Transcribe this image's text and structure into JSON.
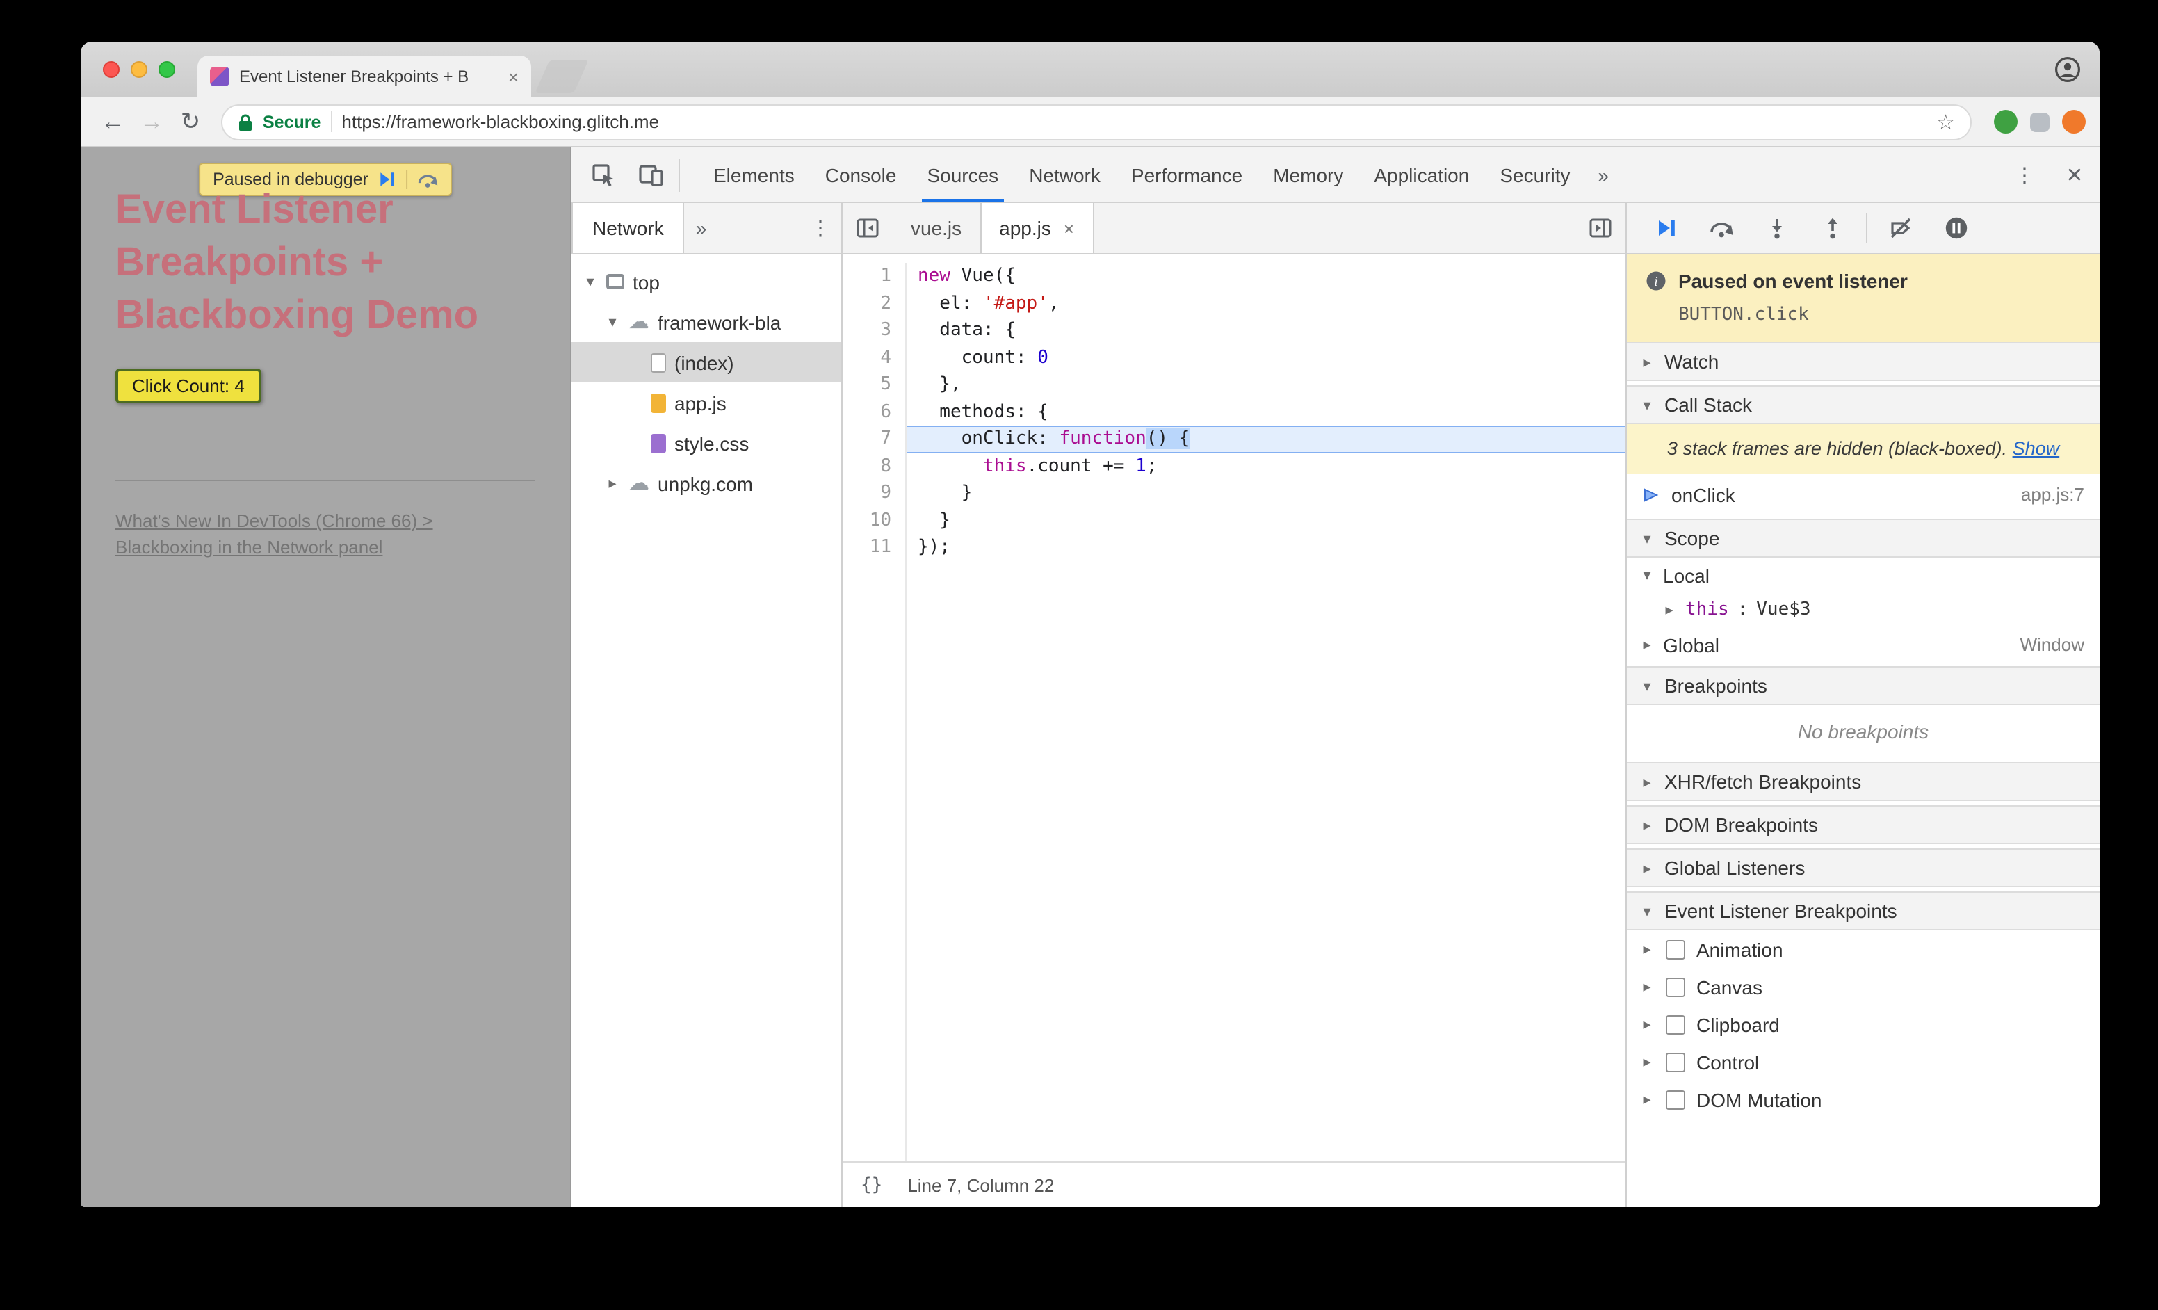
{
  "chrome": {
    "tab_title": "Event Listener Breakpoints + B",
    "secure_label": "Secure",
    "url": "https://framework-blackboxing.glitch.me"
  },
  "page": {
    "paused_banner_label": "Paused in debugger",
    "heading": "Event Listener\nBreakpoints +\nBlackboxing Demo",
    "click_button_label": "Click Count: 4",
    "link_text": "What's New In DevTools (Chrome 66) >\nBlackboxing in the Network panel"
  },
  "devtools": {
    "tabs": [
      "Elements",
      "Console",
      "Sources",
      "Network",
      "Performance",
      "Memory",
      "Application",
      "Security"
    ],
    "active_tab": "Sources",
    "navigator": {
      "active_tab": "Network",
      "tree": [
        {
          "label": "top",
          "icon": "frame",
          "arrow": "expanded",
          "depth": 0
        },
        {
          "label": "framework-bla",
          "icon": "cloud",
          "arrow": "expanded",
          "depth": 1
        },
        {
          "label": "(index)",
          "icon": "document",
          "arrow": "none",
          "depth": 2,
          "selected": true
        },
        {
          "label": "app.js",
          "icon": "js-file",
          "arrow": "none",
          "depth": 2
        },
        {
          "label": "style.css",
          "icon": "css-file",
          "arrow": "none",
          "depth": 2
        },
        {
          "label": "unpkg.com",
          "icon": "cloud",
          "arrow": "collapsed",
          "depth": 1
        }
      ]
    },
    "editor": {
      "tabs": [
        {
          "label": "vue.js",
          "active": false,
          "closable": false
        },
        {
          "label": "app.js",
          "active": true,
          "closable": true
        }
      ],
      "paused_line": 7,
      "code_lines": [
        [
          [
            "kw",
            "new"
          ],
          [
            "pl",
            " Vue({"
          ]
        ],
        [
          [
            "pl",
            "  el: "
          ],
          [
            "str",
            "'#app'"
          ],
          [
            "pl",
            ","
          ]
        ],
        [
          [
            "pl",
            "  data: {"
          ]
        ],
        [
          [
            "pl",
            "    count: "
          ],
          [
            "num",
            "0"
          ]
        ],
        [
          [
            "pl",
            "  },"
          ]
        ],
        [
          [
            "pl",
            "  methods: {"
          ]
        ],
        [
          [
            "pl",
            "    onClick: "
          ],
          [
            "kw",
            "function"
          ],
          [
            "sel",
            "() {"
          ]
        ],
        [
          [
            "pl",
            "      "
          ],
          [
            "kw",
            "this"
          ],
          [
            "pl",
            ".count += "
          ],
          [
            "num",
            "1"
          ],
          [
            "pl",
            ";"
          ]
        ],
        [
          [
            "pl",
            "    }"
          ]
        ],
        [
          [
            "pl",
            "  }"
          ]
        ],
        [
          [
            "pl",
            "});"
          ]
        ]
      ],
      "status_text": "Line 7, Column 22"
    },
    "debugger": {
      "paused_title": "Paused on event listener",
      "paused_detail": "BUTTON.click",
      "watch_label": "Watch",
      "call_stack_label": "Call Stack",
      "blackbox_note": "3 stack frames are hidden (black-boxed).",
      "show_link": "Show",
      "frame_name": "onClick",
      "frame_location": "app.js:7",
      "scope_label": "Scope",
      "scope_local": "Local",
      "scope_this": "this",
      "scope_this_sep": ": ",
      "scope_this_value": "Vue$3",
      "scope_global": "Global",
      "scope_global_value": "Window",
      "breakpoints_label": "Breakpoints",
      "no_breakpoints": "No breakpoints",
      "xhr_label": "XHR/fetch Breakpoints",
      "dom_label": "DOM Breakpoints",
      "global_listeners_label": "Global Listeners",
      "event_listener_label": "Event Listener Breakpoints",
      "listener_categories": [
        "Animation",
        "Canvas",
        "Clipboard",
        "Control",
        "DOM Mutation"
      ]
    }
  },
  "icons": {
    "close_tab": "×",
    "close_panel": "✕",
    "more_vert": "⋮",
    "chevron_double": "»",
    "back": "←",
    "forward": "→",
    "reload": "↻",
    "star": "☆",
    "braces": "{}",
    "tri_down": "▾",
    "tri_right": "▸",
    "cloud": "☁"
  }
}
